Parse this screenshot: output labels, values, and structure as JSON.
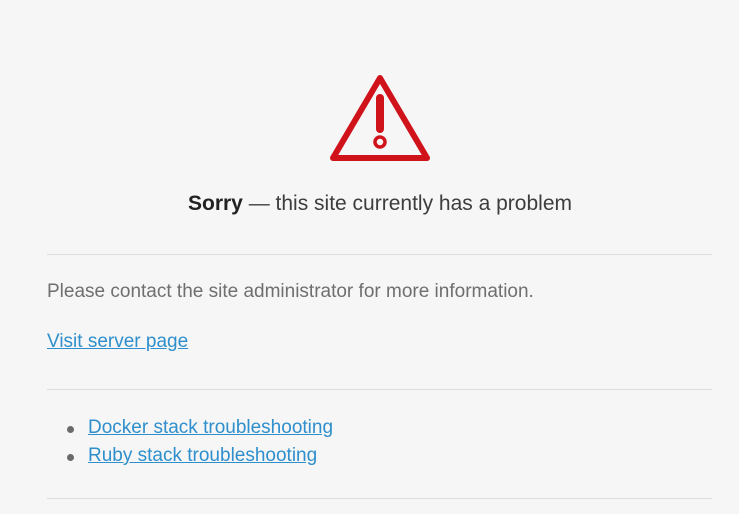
{
  "error": {
    "icon": "warning-triangle-icon",
    "icon_color": "#d0121b",
    "title_strong": "Sorry",
    "title_rest": " — this site currently has a problem",
    "message": "Please contact the site administrator for more information.",
    "server_link": "Visit server page",
    "troubleshooting_links": [
      {
        "label": "Docker stack troubleshooting"
      },
      {
        "label": "Ruby stack troubleshooting"
      }
    ]
  },
  "colors": {
    "link": "#2e8fcc",
    "background": "#f6f6f6"
  }
}
